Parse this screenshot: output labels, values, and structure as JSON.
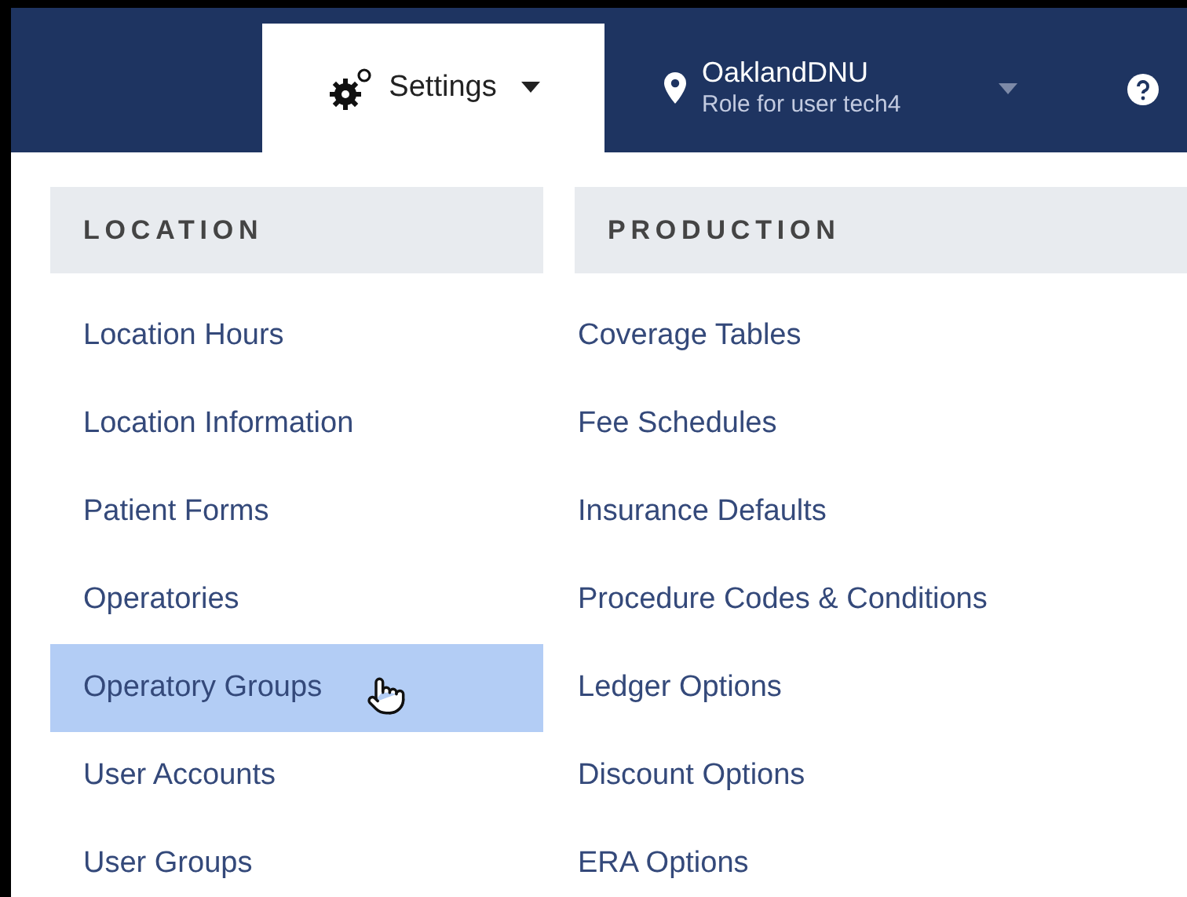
{
  "nav": {
    "settings_tab": {
      "label": "Settings",
      "selected": true
    },
    "location": {
      "name": "OaklandDNU",
      "role": "Role for user tech4"
    }
  },
  "columns": [
    {
      "heading": "LOCATION",
      "items": [
        {
          "label": "Location Hours",
          "selected": false
        },
        {
          "label": "Location Information",
          "selected": false
        },
        {
          "label": "Patient Forms",
          "selected": false
        },
        {
          "label": "Operatories",
          "selected": false
        },
        {
          "label": "Operatory Groups",
          "selected": true
        },
        {
          "label": "User Accounts",
          "selected": false
        },
        {
          "label": "User Groups",
          "selected": false
        }
      ]
    },
    {
      "heading": "PRODUCTION",
      "items": [
        {
          "label": "Coverage Tables",
          "selected": false
        },
        {
          "label": "Fee Schedules",
          "selected": false
        },
        {
          "label": "Insurance Defaults",
          "selected": false
        },
        {
          "label": "Procedure Codes & Conditions",
          "selected": false
        },
        {
          "label": "Ledger Options",
          "selected": false
        },
        {
          "label": "Discount Options",
          "selected": false
        },
        {
          "label": "ERA Options",
          "selected": false
        }
      ]
    }
  ]
}
